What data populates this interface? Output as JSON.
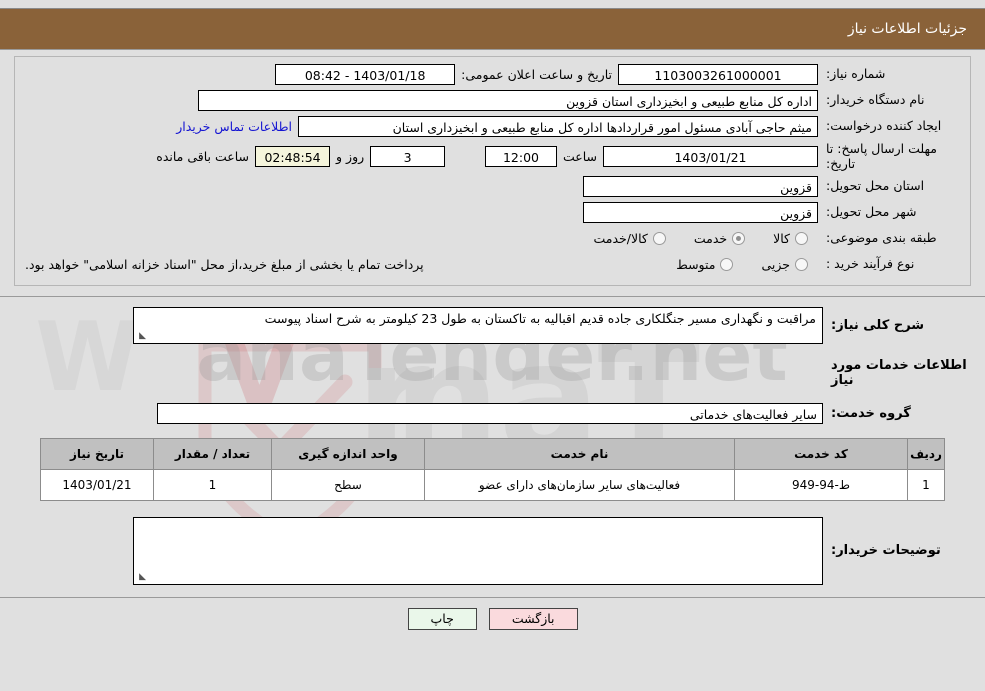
{
  "header": {
    "title": "جزئیات اطلاعات نیاز",
    "bg_color": "#8a6239",
    "text_color": "#ffffff"
  },
  "form": {
    "need_number": {
      "label": "شماره نیاز:",
      "value": "1103003261000001"
    },
    "announce_datetime": {
      "label": "تاریخ و ساعت اعلان عمومی:",
      "value": "1403/01/18 - 08:42"
    },
    "buyer_org": {
      "label": "نام دستگاه خریدار:",
      "value": "اداره کل منابع طبیعی و ابخیزداری استان قزوین"
    },
    "requester": {
      "label": "ایجاد کننده درخواست:",
      "value": "میثم حاجی آبادی مسئول امور قراردادها اداره کل منابع طبیعی و ابخیزداری استان",
      "contact_link": "اطلاعات تماس خریدار",
      "link_color": "#1414d2"
    },
    "deadline": {
      "label": "مهلت ارسال پاسخ: تا تاریخ:",
      "date": "1403/01/21",
      "hour_label": "ساعت",
      "hour": "12:00",
      "days": "3",
      "days_suffix_label": "روز و",
      "remaining": "02:48:54",
      "remaining_label": "ساعت باقی مانده"
    },
    "province": {
      "label": "استان محل تحویل:",
      "value": "قزوین"
    },
    "city": {
      "label": "شهر محل تحویل:",
      "value": "قزوین"
    },
    "classification": {
      "label": "طبقه بندی موضوعی:",
      "options": [
        {
          "label": "کالا",
          "checked": false
        },
        {
          "label": "خدمت",
          "checked": true
        },
        {
          "label": "کالا/خدمت",
          "checked": false
        }
      ]
    },
    "purchase_process": {
      "label": "نوع فرآیند خرید :",
      "options": [
        {
          "label": "جزیی",
          "checked": false
        },
        {
          "label": "متوسط",
          "checked": false
        }
      ],
      "note": "پرداخت تمام یا بخشی از مبلغ خرید،از محل \"اسناد خزانه اسلامی\" خواهد بود."
    }
  },
  "description": {
    "label": "شرح کلی نیاز:",
    "value": "مراقبت و نگهداری مسیر جنگلکاری جاده قدیم اقبالیه به تاکستان به طول 23 کیلومتر به شرح اسناد پیوست"
  },
  "services_section": {
    "heading": "اطلاعات خدمات مورد نیاز",
    "group": {
      "label": "گروه خدمت:",
      "value": "سایر فعالیت‌های خدماتی"
    }
  },
  "items_table": {
    "columns": [
      "ردیف",
      "کد خدمت",
      "نام خدمت",
      "واحد اندازه گیری",
      "تعداد / مقدار",
      "تاریخ نیاز"
    ],
    "rows": [
      {
        "radif": "1",
        "code": "ط-94-949",
        "name": "فعالیت‌های سایر سازمان‌های دارای عضو",
        "unit": "سطح",
        "qty": "1",
        "date": "1403/01/21"
      }
    ]
  },
  "buyer_notes": {
    "label": "توضیحات خریدار:",
    "value": ""
  },
  "footer": {
    "print_button": "چاپ",
    "back_button": "بازگشت"
  },
  "watermark": {
    "text": "anaTender.net"
  }
}
